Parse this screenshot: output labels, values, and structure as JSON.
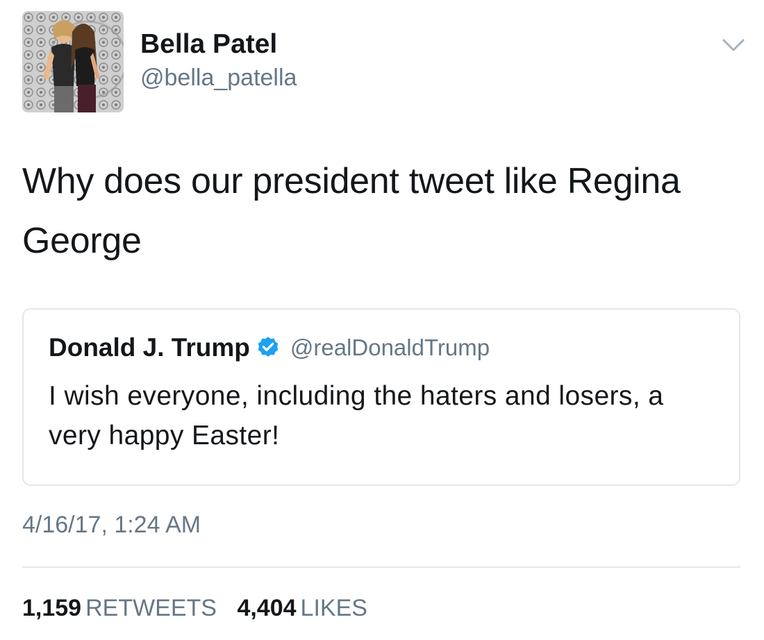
{
  "author": {
    "display_name": "Bella Patel",
    "handle": "@bella_patella",
    "avatar_icon": "profile-photo"
  },
  "tweet": {
    "text": "Why does our president tweet like Regina George"
  },
  "quoted_tweet": {
    "display_name": "Donald J. Trump",
    "verified": true,
    "verified_icon": "verified-badge-icon",
    "handle": "@realDonaldTrump",
    "text": "I wish everyone, including the haters and losers, a very happy Easter!"
  },
  "timestamp": "4/16/17, 1:24 AM",
  "stats": {
    "retweets_count": "1,159",
    "retweets_label": "RETWEETS",
    "likes_count": "4,404",
    "likes_label": "LIKES"
  },
  "colors": {
    "text_primary": "#14171a",
    "text_secondary": "#657786",
    "border": "#e1e8ed",
    "verified_blue": "#1da1f2"
  },
  "menu_icon": "chevron-down-icon"
}
